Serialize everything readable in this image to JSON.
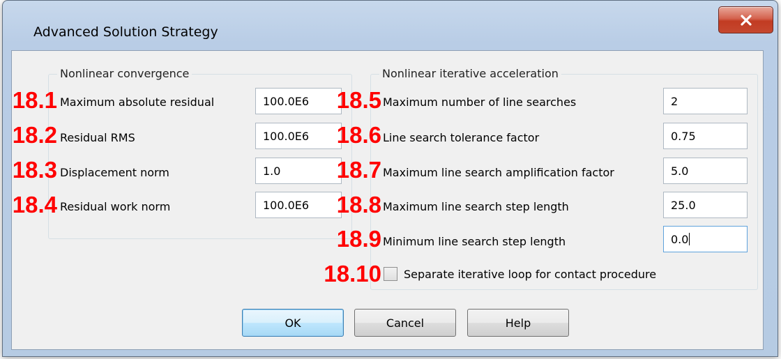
{
  "window": {
    "title": "Advanced Solution Strategy",
    "close_icon": "close-x-icon"
  },
  "convergence": {
    "title": "Nonlinear convergence",
    "items": [
      {
        "num": "18.1",
        "label": "Maximum absolute residual",
        "value": "100.0E6"
      },
      {
        "num": "18.2",
        "label": "Residual RMS",
        "value": "100.0E6"
      },
      {
        "num": "18.3",
        "label": "Displacement norm",
        "value": "1.0"
      },
      {
        "num": "18.4",
        "label": "Residual work norm",
        "value": "100.0E6"
      }
    ]
  },
  "acceleration": {
    "title": "Nonlinear iterative acceleration",
    "items": [
      {
        "num": "18.5",
        "label": "Maximum number of line searches",
        "value": "2"
      },
      {
        "num": "18.6",
        "label": "Line search tolerance factor",
        "value": "0.75"
      },
      {
        "num": "18.7",
        "label": "Maximum line search amplification factor",
        "value": "5.0"
      },
      {
        "num": "18.8",
        "label": "Maximum line search step length",
        "value": "25.0"
      },
      {
        "num": "18.9",
        "label": "Minimum line search step length",
        "value": "0.0"
      }
    ],
    "checkbox": {
      "num": "18.10",
      "label": "Separate iterative loop for contact procedure",
      "checked": false
    }
  },
  "buttons": {
    "ok": "OK",
    "cancel": "Cancel",
    "help": "Help"
  },
  "colors": {
    "annotation": "#ff0000",
    "close_button": "#c9452c",
    "default_button_border": "#3c7fb1"
  }
}
